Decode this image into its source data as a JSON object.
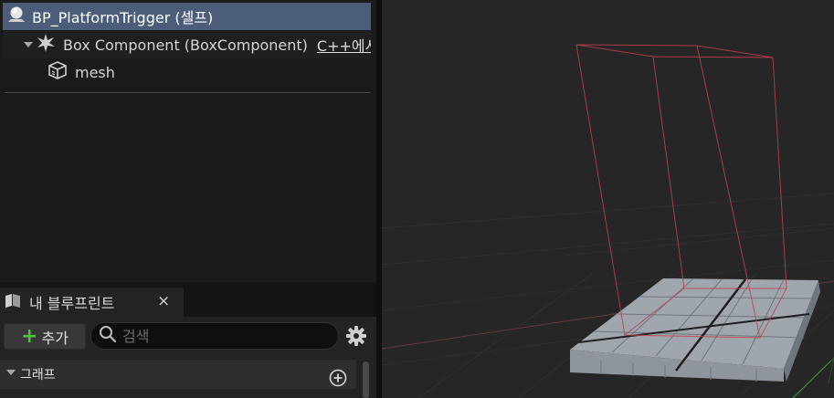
{
  "components": {
    "root_label": "BP_PlatformTrigger (셀프)",
    "box_label": "Box Component (BoxComponent)",
    "box_link": "C++에서",
    "mesh_label": "mesh"
  },
  "my_blueprint": {
    "tab_label": "내 블루프린트",
    "tab_close": "×",
    "add_label": "추가",
    "search_placeholder": "검색",
    "graph_section_label": "그래프"
  },
  "icons": {
    "root": "actor-sphere-icon",
    "box": "box-collision-icon",
    "mesh": "static-mesh-cube-icon",
    "tab": "blueprint-book-icon",
    "search": "search-icon",
    "settings": "gear-icon",
    "add_graph": "plus-circle-icon"
  },
  "colors": {
    "selection": "#4b5d78",
    "add_plus": "#4ec13c",
    "trigger_wireframe": "#c2404a",
    "grid_x_axis": "#b34a3d",
    "grid_y_axis": "#3f9e3a"
  }
}
